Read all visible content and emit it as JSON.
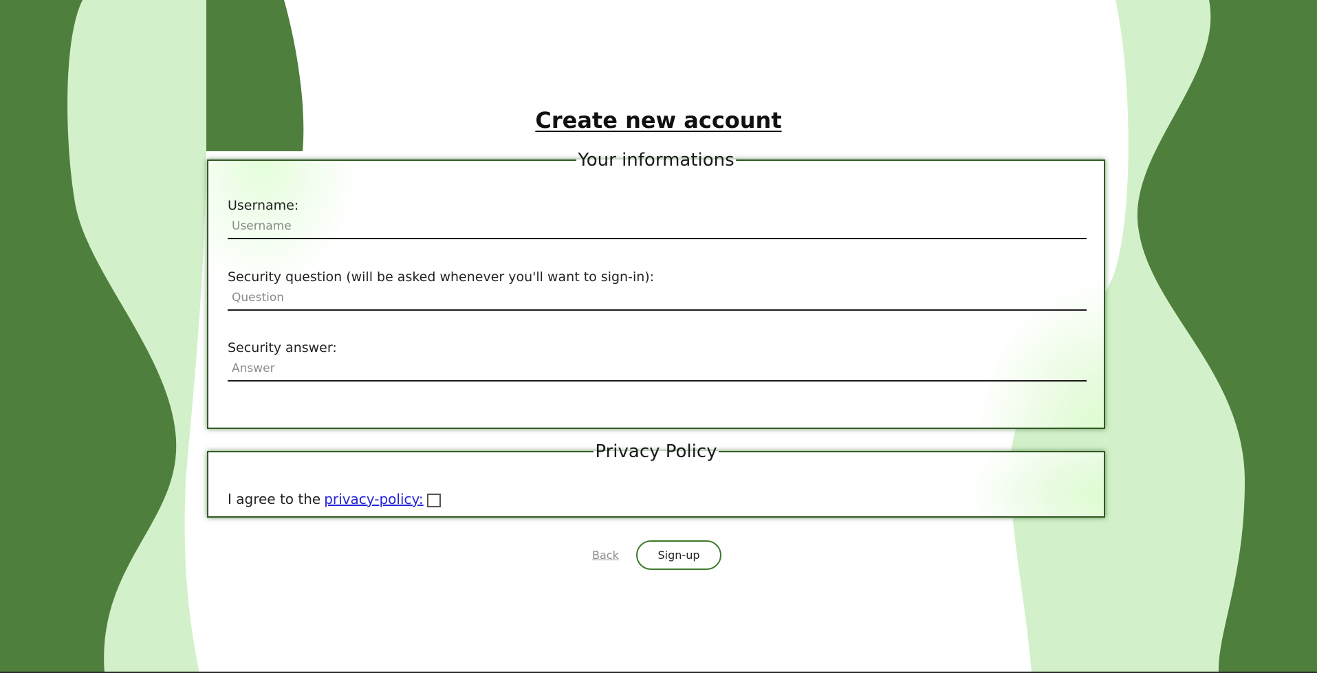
{
  "page": {
    "title": "Create new account"
  },
  "colors": {
    "background_dark": "#4e7f3c",
    "background_light": "#d2f1ca",
    "panel_border": "#2f5a22",
    "button_border": "#3d7a2c",
    "link": "#2424d6",
    "back_link": "#8a8a8a"
  },
  "info_section": {
    "legend": "Your informations",
    "username": {
      "label": "Username:",
      "placeholder": "Username",
      "value": ""
    },
    "question": {
      "label": "Security question (will be asked whenever you'll want to sign-in):",
      "placeholder": "Question",
      "value": ""
    },
    "answer": {
      "label": "Security answer:",
      "placeholder": "Answer",
      "value": ""
    }
  },
  "privacy_section": {
    "legend": "Privacy Policy",
    "agree_text": "I agree to the",
    "link_text": "privacy-policy:",
    "checked": false
  },
  "actions": {
    "back_label": "Back",
    "signup_label": "Sign-up"
  }
}
